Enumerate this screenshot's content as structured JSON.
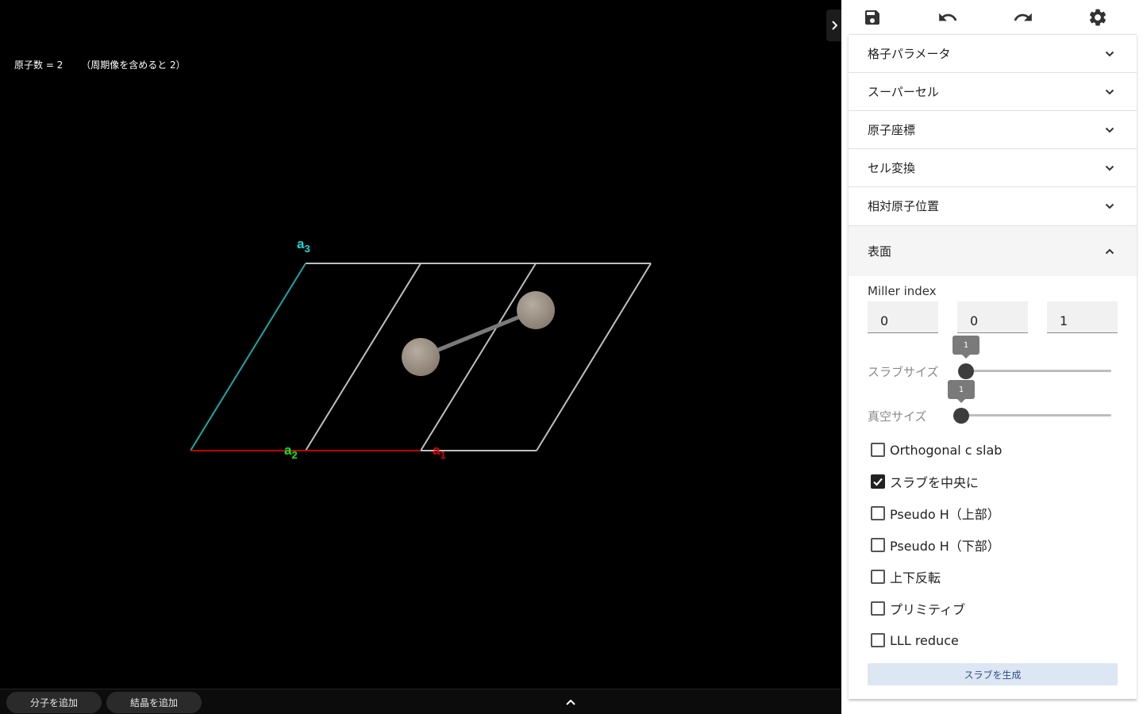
{
  "viewer": {
    "atom_count_text": "原子数 = 2      （周期像を含めると 2）",
    "axes": {
      "a1": {
        "base": "a",
        "sub": "1",
        "color": "#e00000"
      },
      "a2": {
        "base": "a",
        "sub": "2",
        "color": "#19e619"
      },
      "a3": {
        "base": "a",
        "sub": "3",
        "color": "#19d9d9"
      }
    },
    "bottom_bar": {
      "add_molecule": "分子を追加",
      "add_crystal": "結晶を追加",
      "expand_icon": "chevron-up-icon"
    },
    "panel_toggle_icon": "chevron-right-icon"
  },
  "toolbar": {
    "icons": [
      "save-icon",
      "undo-icon",
      "redo-icon",
      "gear-icon"
    ]
  },
  "accordion": {
    "sections": [
      {
        "label": "格子パラメータ",
        "expanded": false
      },
      {
        "label": "スーパーセル",
        "expanded": false
      },
      {
        "label": "原子座標",
        "expanded": false
      },
      {
        "label": "セル変換",
        "expanded": false
      },
      {
        "label": "相対原子位置",
        "expanded": false
      },
      {
        "label": "表面",
        "expanded": true
      }
    ]
  },
  "surface": {
    "miller_label": "Miller index",
    "miller": [
      "0",
      "0",
      "1"
    ],
    "slab_size": {
      "label": "スラブサイズ",
      "value": "1"
    },
    "vacuum_size": {
      "label": "真空サイズ",
      "value": "1"
    },
    "options": [
      {
        "label": "Orthogonal c slab",
        "checked": false
      },
      {
        "label": "スラブを中央に",
        "checked": true
      },
      {
        "label": "Pseudo H（上部）",
        "checked": false
      },
      {
        "label": "Pseudo H（下部）",
        "checked": false
      },
      {
        "label": "上下反転",
        "checked": false
      },
      {
        "label": "プリミティブ",
        "checked": false
      },
      {
        "label": "LLL reduce",
        "checked": false
      }
    ],
    "generate_button": "スラブを生成"
  },
  "colors": {
    "cell_line": "#bfbfbf",
    "atom": "#9c8f83",
    "bond": "#7a7a7a",
    "accent_dark": "#222222"
  }
}
